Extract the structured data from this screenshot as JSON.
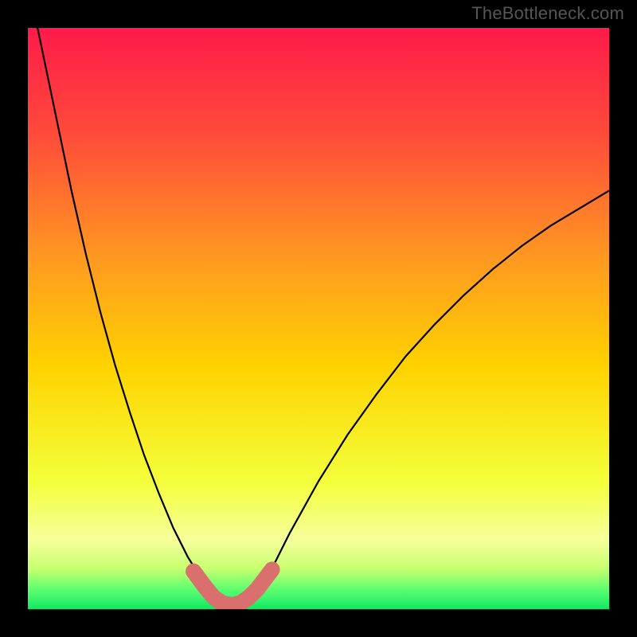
{
  "watermark": "TheBottleneck.com",
  "colors": {
    "background": "#000000",
    "gradient_top": "#ff1a4a",
    "gradient_mid": "#ffd200",
    "gradient_low": "#f6ff6a",
    "gradient_bottom": "#10ff70",
    "curve": "#000000",
    "marker_fill": "#d9706e",
    "marker_stroke": "#bb5856"
  },
  "chart_data": {
    "type": "line",
    "title": "",
    "xlabel": "",
    "ylabel": "",
    "xlim": [
      0,
      10
    ],
    "ylim": [
      0,
      100
    ],
    "grid": false,
    "series": [
      {
        "name": "bottleneck-curve",
        "x": [
          0.0,
          0.25,
          0.5,
          0.75,
          1.0,
          1.25,
          1.5,
          1.75,
          2.0,
          2.25,
          2.5,
          2.75,
          3.0,
          3.2,
          3.4,
          3.6,
          3.8,
          4.0,
          4.25,
          4.5,
          5.0,
          5.5,
          6.0,
          6.5,
          7.0,
          7.5,
          8.0,
          8.5,
          9.0,
          9.5,
          10.0
        ],
        "y": [
          108.0,
          96.0,
          84.0,
          72.0,
          61.0,
          51.0,
          42.0,
          34.0,
          26.5,
          20.0,
          14.0,
          9.0,
          5.0,
          2.5,
          1.0,
          1.0,
          2.0,
          4.0,
          8.0,
          13.0,
          22.0,
          30.0,
          37.0,
          43.5,
          49.0,
          54.0,
          58.5,
          62.5,
          66.0,
          69.0,
          72.0
        ]
      }
    ],
    "markers": [
      {
        "x": 2.85,
        "y": 6.5,
        "r": 5
      },
      {
        "x": 3.05,
        "y": 3.8,
        "r": 6
      },
      {
        "x": 3.2,
        "y": 2.0,
        "r": 6
      },
      {
        "x": 3.35,
        "y": 1.0,
        "r": 6
      },
      {
        "x": 3.5,
        "y": 0.7,
        "r": 6
      },
      {
        "x": 3.65,
        "y": 1.0,
        "r": 6
      },
      {
        "x": 3.8,
        "y": 2.0,
        "r": 6
      },
      {
        "x": 3.95,
        "y": 3.5,
        "r": 6
      },
      {
        "x": 4.2,
        "y": 6.8,
        "r": 5
      }
    ],
    "gradient_stops": [
      {
        "offset": 0.0,
        "color": "#ff1a4a"
      },
      {
        "offset": 0.18,
        "color": "#ff4a3a"
      },
      {
        "offset": 0.4,
        "color": "#ff9a20"
      },
      {
        "offset": 0.58,
        "color": "#ffd200"
      },
      {
        "offset": 0.78,
        "color": "#f3ff3a"
      },
      {
        "offset": 0.88,
        "color": "#f6ff9a"
      },
      {
        "offset": 0.93,
        "color": "#c8ff70"
      },
      {
        "offset": 0.965,
        "color": "#60ff70"
      },
      {
        "offset": 1.0,
        "color": "#10e864"
      }
    ]
  }
}
